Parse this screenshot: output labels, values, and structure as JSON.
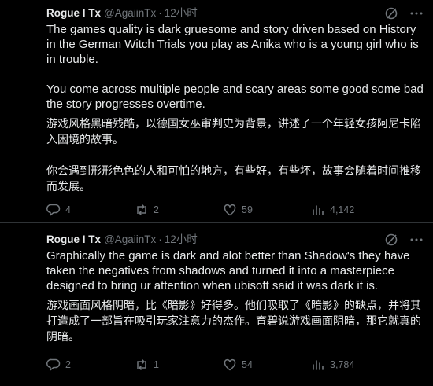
{
  "tweets": [
    {
      "display_name": "Rogue I Tx",
      "handle": "@AgaiinTx",
      "separator": "·",
      "time": "12小时",
      "text_en_1": "The games quality is dark gruesome and story driven based on History in the German Witch Trials you play as Anika who is a young girl who is in trouble.",
      "text_en_2": "You come across multiple people and scary areas some good some bad the story progresses overtime.",
      "text_zh_1": "游戏风格黑暗残酷，以德国女巫审判史为背景，讲述了一个年轻女孩阿尼卡陷入困境的故事。",
      "text_zh_2": "你会遇到形形色色的人和可怕的地方，有些好，有些坏，故事会随着时间推移而发展。",
      "replies": "4",
      "retweets": "2",
      "likes": "59",
      "views": "4,142"
    },
    {
      "display_name": "Rogue I Tx",
      "handle": "@AgaiinTx",
      "separator": "·",
      "time": "12小时",
      "text_en_1": "Graphically the game is dark and alot better than Shadow's they have taken the negatives from shadows and turned it into a masterpiece designed to bring ur attention when ubisoft said it was dark it is.",
      "text_zh_1": "游戏画面风格阴暗，比《暗影》好得多。他们吸取了《暗影》的缺点，并将其打造成了一部旨在吸引玩家注意力的杰作。育碧说游戏画面阴暗，那它就真的阴暗。",
      "replies": "2",
      "retweets": "1",
      "likes": "54",
      "views": "3,784"
    }
  ],
  "icons": {
    "translate": "grok-icon",
    "more": "more-icon",
    "reply": "reply-icon",
    "retweet": "retweet-icon",
    "like": "heart-icon",
    "views": "views-icon",
    "share": "share-icon"
  },
  "colors": {
    "background": "#000000",
    "text": "#e7e9ea",
    "muted": "#71767b",
    "divider": "#2f3336"
  }
}
